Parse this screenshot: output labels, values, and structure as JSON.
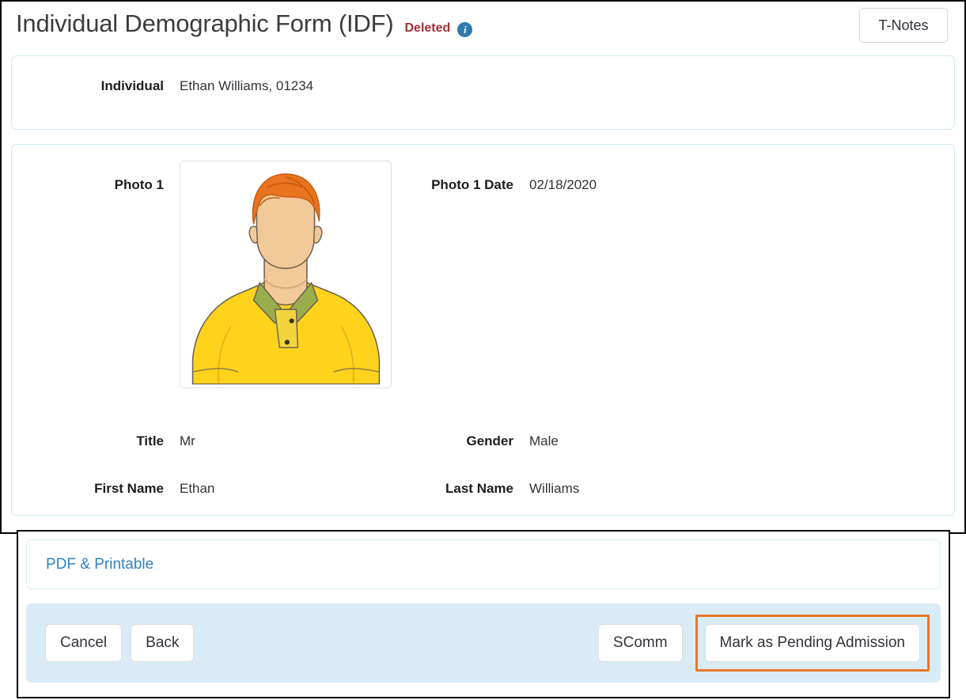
{
  "header": {
    "title": "Individual Demographic Form (IDF)",
    "status_flag": "Deleted",
    "info_icon": "info-circle-icon",
    "tnotes_label": "T-Notes"
  },
  "individual_card": {
    "label": "Individual",
    "value": "Ethan Williams, 01234"
  },
  "details_card": {
    "photo": {
      "label": "Photo 1",
      "alt": "male-avatar-illustration"
    },
    "photo_date": {
      "label": "Photo 1 Date",
      "value": "02/18/2020"
    },
    "rows": [
      {
        "left": {
          "label": "Title",
          "value": "Mr"
        },
        "right": {
          "label": "Gender",
          "value": "Male"
        }
      },
      {
        "left": {
          "label": "First Name",
          "value": "Ethan"
        },
        "right": {
          "label": "Last Name",
          "value": "Williams"
        }
      }
    ]
  },
  "bottom_panel": {
    "pdf_link": "PDF & Printable",
    "buttons": {
      "cancel": "Cancel",
      "back": "Back",
      "scomm": "SComm",
      "mark_pending": "Mark as Pending Admission"
    }
  },
  "colors": {
    "status_red": "#a03136",
    "info_blue": "#2e7bab",
    "link_blue": "#3282c4",
    "action_bar_bg": "#d9ecf5",
    "highlight_orange": "#e8762c",
    "card_border": "#cfe9f0",
    "hair": "#e8741f",
    "skin": "#f2c998",
    "shirt": "#ffd21c",
    "collar": "#9aad4c"
  }
}
